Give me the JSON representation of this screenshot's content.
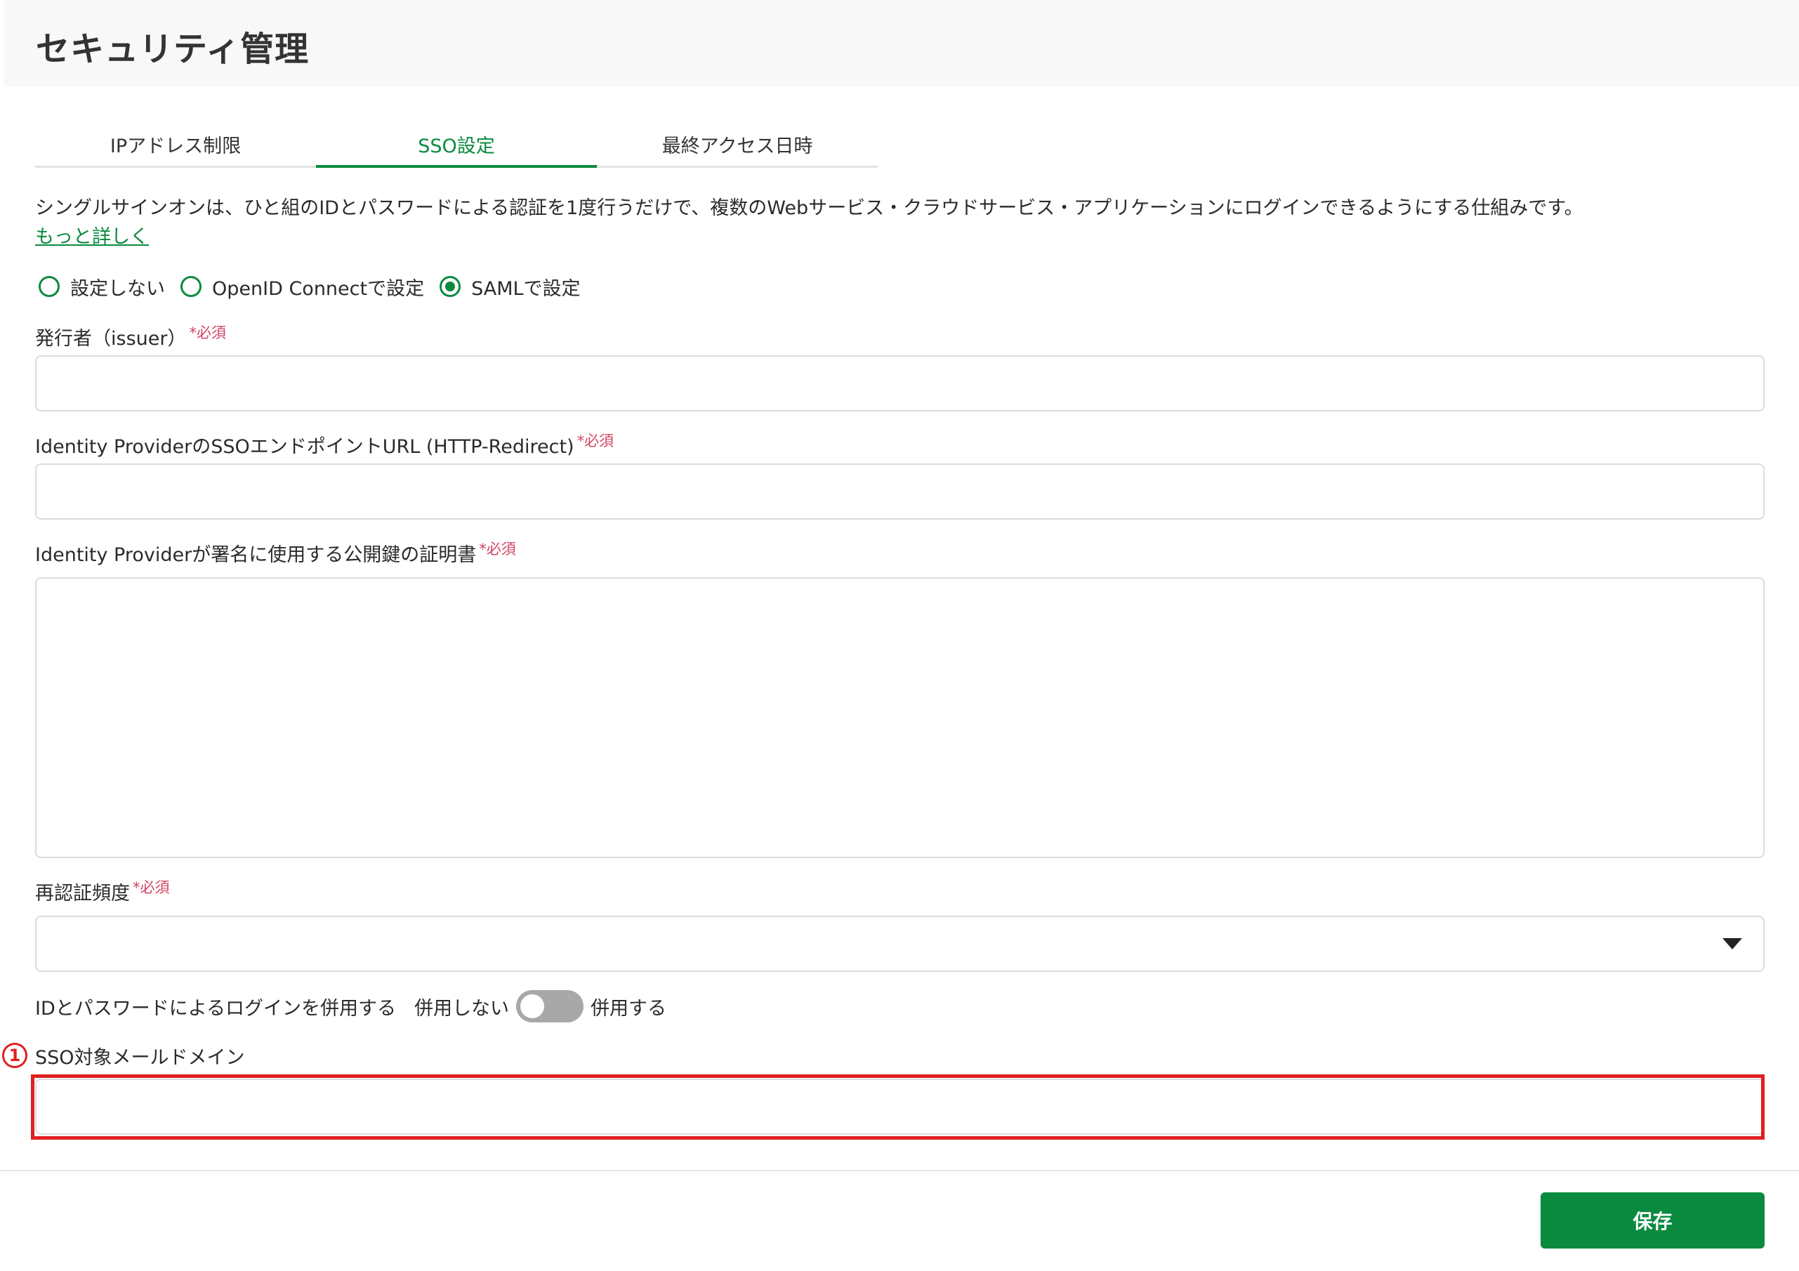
{
  "header": {
    "title": "セキュリティ管理"
  },
  "tabs": [
    {
      "label": "IPアドレス制限",
      "active": false
    },
    {
      "label": "SSO設定",
      "active": true
    },
    {
      "label": "最終アクセス日時",
      "active": false
    }
  ],
  "description": "シングルサインオンは、ひと組のIDとパスワードによる認証を1度行うだけで、複数のWebサービス・クラウドサービス・アプリケーションにログインできるようにする仕組みです。",
  "more_link": "もっと詳しく",
  "sso_mode": {
    "options": [
      {
        "label": "設定しない",
        "checked": false
      },
      {
        "label": "OpenID Connectで設定",
        "checked": false
      },
      {
        "label": "SAMLで設定",
        "checked": true
      }
    ]
  },
  "fields": {
    "issuer": {
      "label": "発行者（issuer）",
      "required": "*必須",
      "value": ""
    },
    "sso_endpoint": {
      "label": "Identity ProviderのSSOエンドポイントURL (HTTP-Redirect)",
      "required": "*必須",
      "value": ""
    },
    "certificate": {
      "label": "Identity Providerが署名に使用する公開鍵の証明書",
      "required": "*必須",
      "value": ""
    },
    "reauth_frequency": {
      "label": "再認証頻度",
      "required": "*必須",
      "value": ""
    },
    "mail_domain": {
      "label": "SSO対象メールドメイン",
      "value": ""
    }
  },
  "id_password_login": {
    "label": "IDとパスワードによるログインを併用する",
    "off_label": "併用しない",
    "on_label": "併用する",
    "enabled": false
  },
  "annotation": {
    "number": "1"
  },
  "footer": {
    "save_label": "保存"
  },
  "colors": {
    "accent": "#0a8a3f",
    "required": "#d24463",
    "annotation": "#e02020"
  }
}
